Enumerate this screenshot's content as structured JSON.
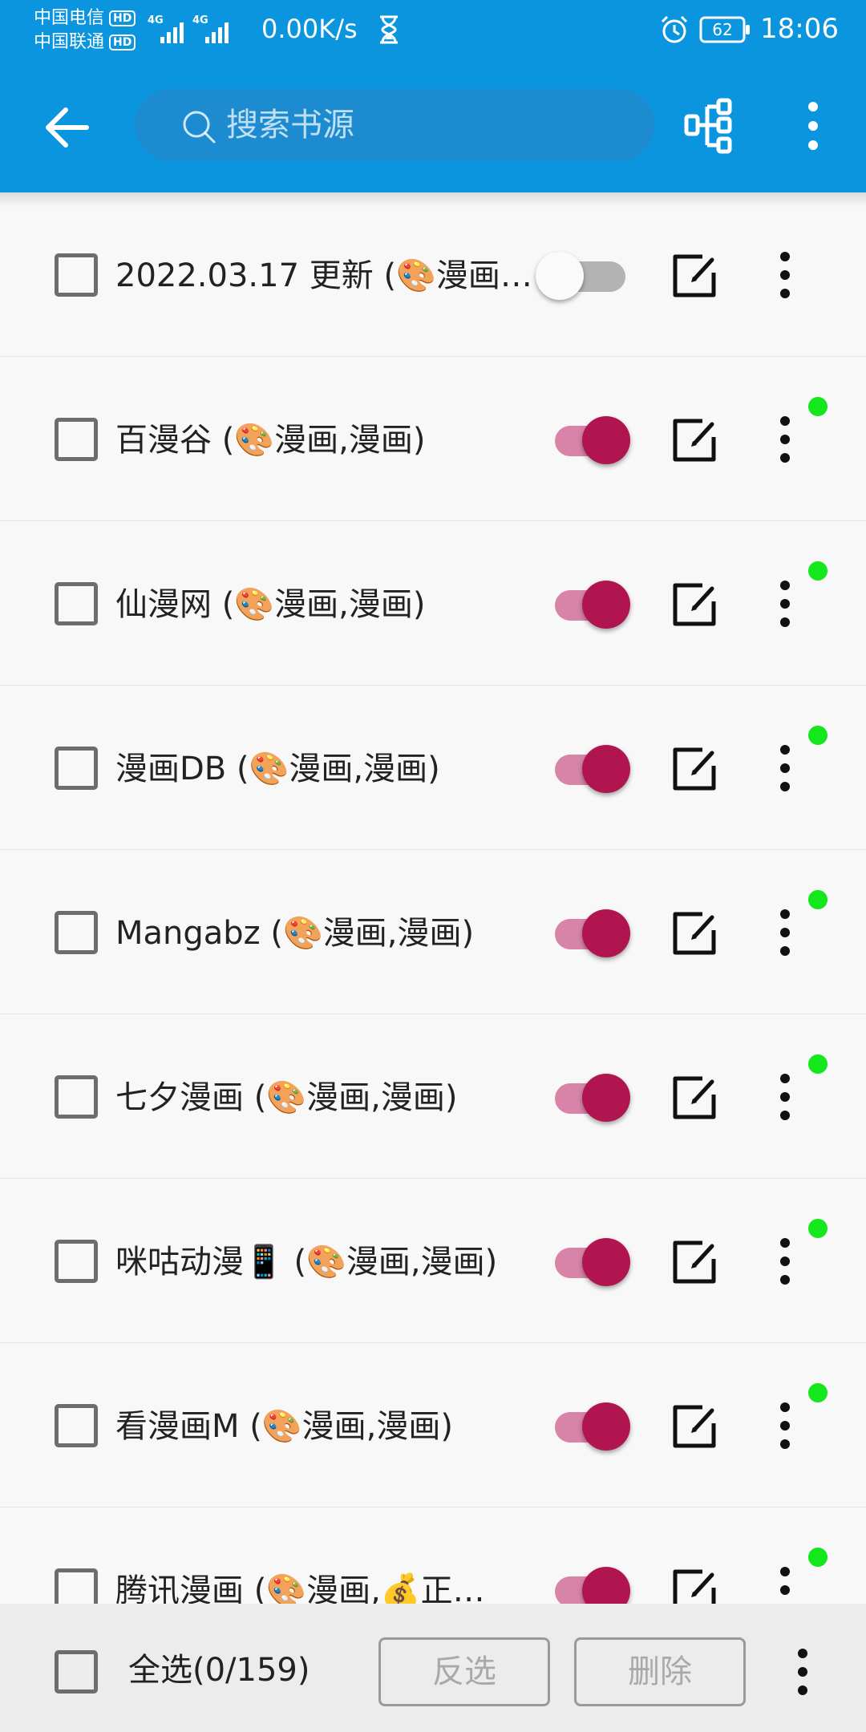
{
  "status_bar": {
    "carrier_1": "中国电信",
    "carrier_2": "中国联通",
    "hd_badge": "HD",
    "network_gen": "4G",
    "net_speed": "0.00K/s",
    "battery": "62",
    "time": "18:06"
  },
  "toolbar": {
    "search_placeholder": "搜索书源"
  },
  "sources": [
    {
      "label": "2022.03.17 更新 (🎨漫画…",
      "enabled": false,
      "dot": false
    },
    {
      "label": "百漫谷 (🎨漫画,漫画)",
      "enabled": true,
      "dot": true
    },
    {
      "label": "仙漫网 (🎨漫画,漫画)",
      "enabled": true,
      "dot": true
    },
    {
      "label": "漫画DB (🎨漫画,漫画)",
      "enabled": true,
      "dot": true
    },
    {
      "label": "Mangabz (🎨漫画,漫画)",
      "enabled": true,
      "dot": true
    },
    {
      "label": "七夕漫画 (🎨漫画,漫画)",
      "enabled": true,
      "dot": true
    },
    {
      "label": "咪咕动漫📱 (🎨漫画,漫画)",
      "enabled": true,
      "dot": true
    },
    {
      "label": "看漫画M (🎨漫画,漫画)",
      "enabled": true,
      "dot": true
    },
    {
      "label": "腾讯漫画 (🎨漫画,💰正…",
      "enabled": true,
      "dot": true
    }
  ],
  "bottom_bar": {
    "select_all": "全选(0/159)",
    "invert": "反选",
    "delete": "删除"
  },
  "colors": {
    "primary": "#0a95de",
    "switch_on": "#b0154f",
    "status_dot": "#14e71c"
  }
}
